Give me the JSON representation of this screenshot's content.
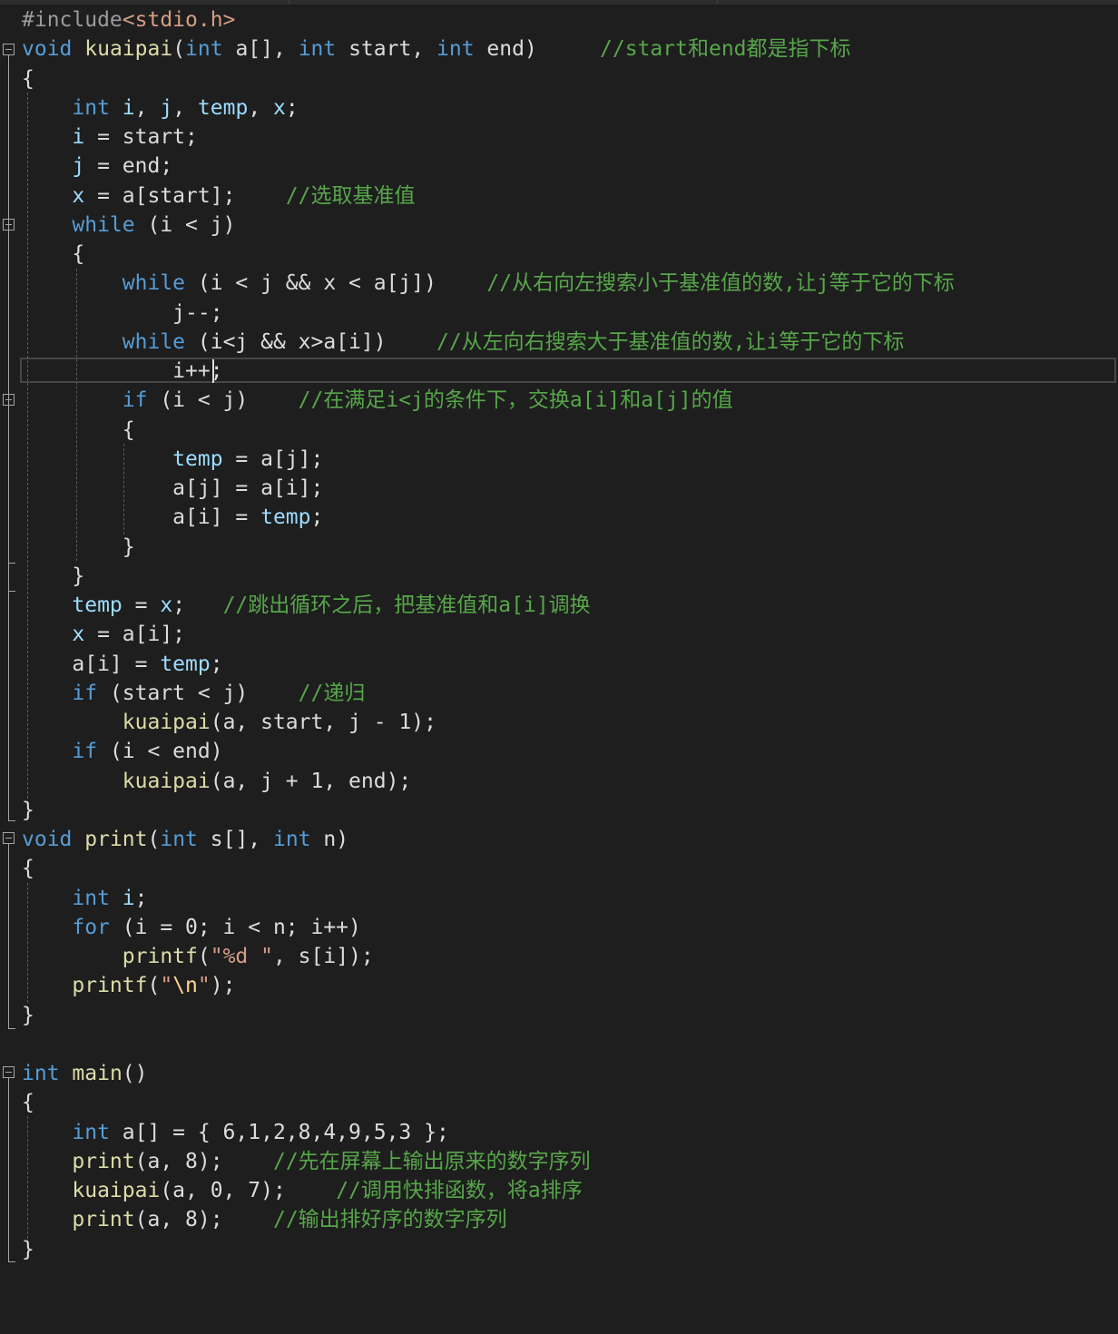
{
  "editor": {
    "language": "C",
    "current_line_index": 12,
    "colors": {
      "background": "#1e1e1e",
      "keyword": "#569cd6",
      "function": "#dcdcaa",
      "variable": "#9cdcfe",
      "preprocessor": "#9b9b9b",
      "string": "#d69d85",
      "number": "#b5cea8",
      "comment": "#57a64a",
      "default_text": "#dcdcdc"
    },
    "lines": [
      [
        {
          "t": "#include",
          "c": "pp"
        },
        {
          "t": "<stdio.h>",
          "c": "str"
        }
      ],
      [
        {
          "t": "void",
          "c": "kw"
        },
        {
          "t": " "
        },
        {
          "t": "kuaipai",
          "c": "fn"
        },
        {
          "t": "("
        },
        {
          "t": "int",
          "c": "kw"
        },
        {
          "t": " a[], "
        },
        {
          "t": "int",
          "c": "kw"
        },
        {
          "t": " start, "
        },
        {
          "t": "int",
          "c": "kw"
        },
        {
          "t": " end)     "
        },
        {
          "t": "//start和end都是指下标",
          "c": "cm"
        }
      ],
      [
        {
          "t": "{"
        }
      ],
      [
        {
          "t": "    "
        },
        {
          "t": "int",
          "c": "kw"
        },
        {
          "t": " "
        },
        {
          "t": "i",
          "c": "var"
        },
        {
          "t": ", "
        },
        {
          "t": "j",
          "c": "var"
        },
        {
          "t": ", "
        },
        {
          "t": "temp",
          "c": "var"
        },
        {
          "t": ", "
        },
        {
          "t": "x",
          "c": "var"
        },
        {
          "t": ";"
        }
      ],
      [
        {
          "t": "    "
        },
        {
          "t": "i",
          "c": "var"
        },
        {
          "t": " = start;"
        }
      ],
      [
        {
          "t": "    "
        },
        {
          "t": "j",
          "c": "var"
        },
        {
          "t": " = end;"
        }
      ],
      [
        {
          "t": "    "
        },
        {
          "t": "x",
          "c": "var"
        },
        {
          "t": " = a[start];    "
        },
        {
          "t": "//选取基准值",
          "c": "cm"
        }
      ],
      [
        {
          "t": "    "
        },
        {
          "t": "while",
          "c": "kw"
        },
        {
          "t": " (i < j)"
        }
      ],
      [
        {
          "t": "    {"
        }
      ],
      [
        {
          "t": "        "
        },
        {
          "t": "while",
          "c": "kw"
        },
        {
          "t": " (i < j && x < a[j])    "
        },
        {
          "t": "//从右向左搜索小于基准值的数,让j等于它的下标",
          "c": "cm"
        }
      ],
      [
        {
          "t": "            j--;"
        }
      ],
      [
        {
          "t": "        "
        },
        {
          "t": "while",
          "c": "kw"
        },
        {
          "t": " (i<j && x>a[i])    "
        },
        {
          "t": "//从左向右搜索大于基准值的数,让i等于它的下标",
          "c": "cm"
        }
      ],
      [
        {
          "t": "            i++;"
        }
      ],
      [
        {
          "t": "        "
        },
        {
          "t": "if",
          "c": "kw"
        },
        {
          "t": " (i < j)    "
        },
        {
          "t": "//在满足i<j的条件下，交换a[i]和a[j]的值",
          "c": "cm"
        }
      ],
      [
        {
          "t": "        {"
        }
      ],
      [
        {
          "t": "            "
        },
        {
          "t": "temp",
          "c": "var"
        },
        {
          "t": " = a[j];"
        }
      ],
      [
        {
          "t": "            a[j] = a[i];"
        }
      ],
      [
        {
          "t": "            a[i] = "
        },
        {
          "t": "temp",
          "c": "var"
        },
        {
          "t": ";"
        }
      ],
      [
        {
          "t": "        }"
        }
      ],
      [
        {
          "t": "    }"
        }
      ],
      [
        {
          "t": "    "
        },
        {
          "t": "temp",
          "c": "var"
        },
        {
          "t": " = "
        },
        {
          "t": "x",
          "c": "var"
        },
        {
          "t": ";   "
        },
        {
          "t": "//跳出循环之后，把基准值和a[i]调换",
          "c": "cm"
        }
      ],
      [
        {
          "t": "    "
        },
        {
          "t": "x",
          "c": "var"
        },
        {
          "t": " = a[i];"
        }
      ],
      [
        {
          "t": "    a[i] = "
        },
        {
          "t": "temp",
          "c": "var"
        },
        {
          "t": ";"
        }
      ],
      [
        {
          "t": "    "
        },
        {
          "t": "if",
          "c": "kw"
        },
        {
          "t": " (start < j)    "
        },
        {
          "t": "//递归",
          "c": "cm"
        }
      ],
      [
        {
          "t": "        "
        },
        {
          "t": "kuaipai",
          "c": "fn"
        },
        {
          "t": "(a, start, j - 1);"
        }
      ],
      [
        {
          "t": "    "
        },
        {
          "t": "if",
          "c": "kw"
        },
        {
          "t": " (i < end)"
        }
      ],
      [
        {
          "t": "        "
        },
        {
          "t": "kuaipai",
          "c": "fn"
        },
        {
          "t": "(a, j + 1, end);"
        }
      ],
      [
        {
          "t": "}"
        }
      ],
      [
        {
          "t": "void",
          "c": "kw"
        },
        {
          "t": " "
        },
        {
          "t": "print",
          "c": "fn"
        },
        {
          "t": "("
        },
        {
          "t": "int",
          "c": "kw"
        },
        {
          "t": " s[], "
        },
        {
          "t": "int",
          "c": "kw"
        },
        {
          "t": " n)"
        }
      ],
      [
        {
          "t": "{"
        }
      ],
      [
        {
          "t": "    "
        },
        {
          "t": "int",
          "c": "kw"
        },
        {
          "t": " "
        },
        {
          "t": "i",
          "c": "var"
        },
        {
          "t": ";"
        }
      ],
      [
        {
          "t": "    "
        },
        {
          "t": "for",
          "c": "kw"
        },
        {
          "t": " (i = 0; i < n; i++)"
        }
      ],
      [
        {
          "t": "        "
        },
        {
          "t": "printf",
          "c": "fn"
        },
        {
          "t": "("
        },
        {
          "t": "\"%d \"",
          "c": "str"
        },
        {
          "t": ", s[i]);"
        }
      ],
      [
        {
          "t": "    "
        },
        {
          "t": "printf",
          "c": "fn"
        },
        {
          "t": "("
        },
        {
          "t": "\"",
          "c": "str"
        },
        {
          "t": "\\n",
          "c": "esc"
        },
        {
          "t": "\"",
          "c": "str"
        },
        {
          "t": ");"
        }
      ],
      [
        {
          "t": "}"
        }
      ],
      [],
      [
        {
          "t": "int",
          "c": "kw"
        },
        {
          "t": " "
        },
        {
          "t": "main",
          "c": "fn"
        },
        {
          "t": "()"
        }
      ],
      [
        {
          "t": "{"
        }
      ],
      [
        {
          "t": "    "
        },
        {
          "t": "int",
          "c": "kw"
        },
        {
          "t": " a[] = { 6,1,2,8,4,9,5,3 };"
        }
      ],
      [
        {
          "t": "    "
        },
        {
          "t": "print",
          "c": "fn"
        },
        {
          "t": "(a, 8);    "
        },
        {
          "t": "//先在屏幕上输出原来的数字序列",
          "c": "cm"
        }
      ],
      [
        {
          "t": "    "
        },
        {
          "t": "kuaipai",
          "c": "fn"
        },
        {
          "t": "(a, 0, 7);    "
        },
        {
          "t": "//调用快排函数，将a排序",
          "c": "cm"
        }
      ],
      [
        {
          "t": "    "
        },
        {
          "t": "print",
          "c": "fn"
        },
        {
          "t": "(a, 8);    "
        },
        {
          "t": "//输出排好序的数字序列",
          "c": "cm"
        }
      ],
      [
        {
          "t": "}"
        }
      ]
    ]
  }
}
